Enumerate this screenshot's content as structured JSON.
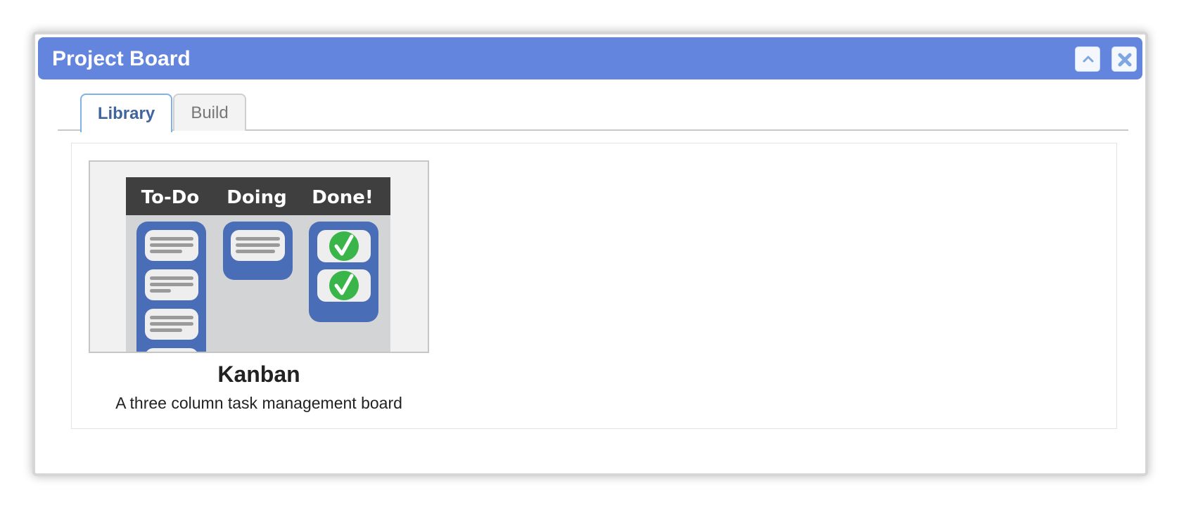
{
  "window": {
    "title": "Project Board",
    "titlebar_color": "#6385de",
    "buttons": {
      "collapse_icon": "chevron-up-icon",
      "close_icon": "close-icon"
    }
  },
  "tabs": [
    {
      "label": "Library",
      "active": true
    },
    {
      "label": "Build",
      "active": false
    }
  ],
  "library": {
    "items": [
      {
        "name": "Kanban",
        "description": "A three column task management board",
        "thumbnail": {
          "columns": [
            "To-Do",
            "Doing",
            "Done!"
          ],
          "column_color": "#4a6db8",
          "header_color": "#3f3f3f",
          "check_color": "#3ab54a"
        }
      }
    ]
  }
}
